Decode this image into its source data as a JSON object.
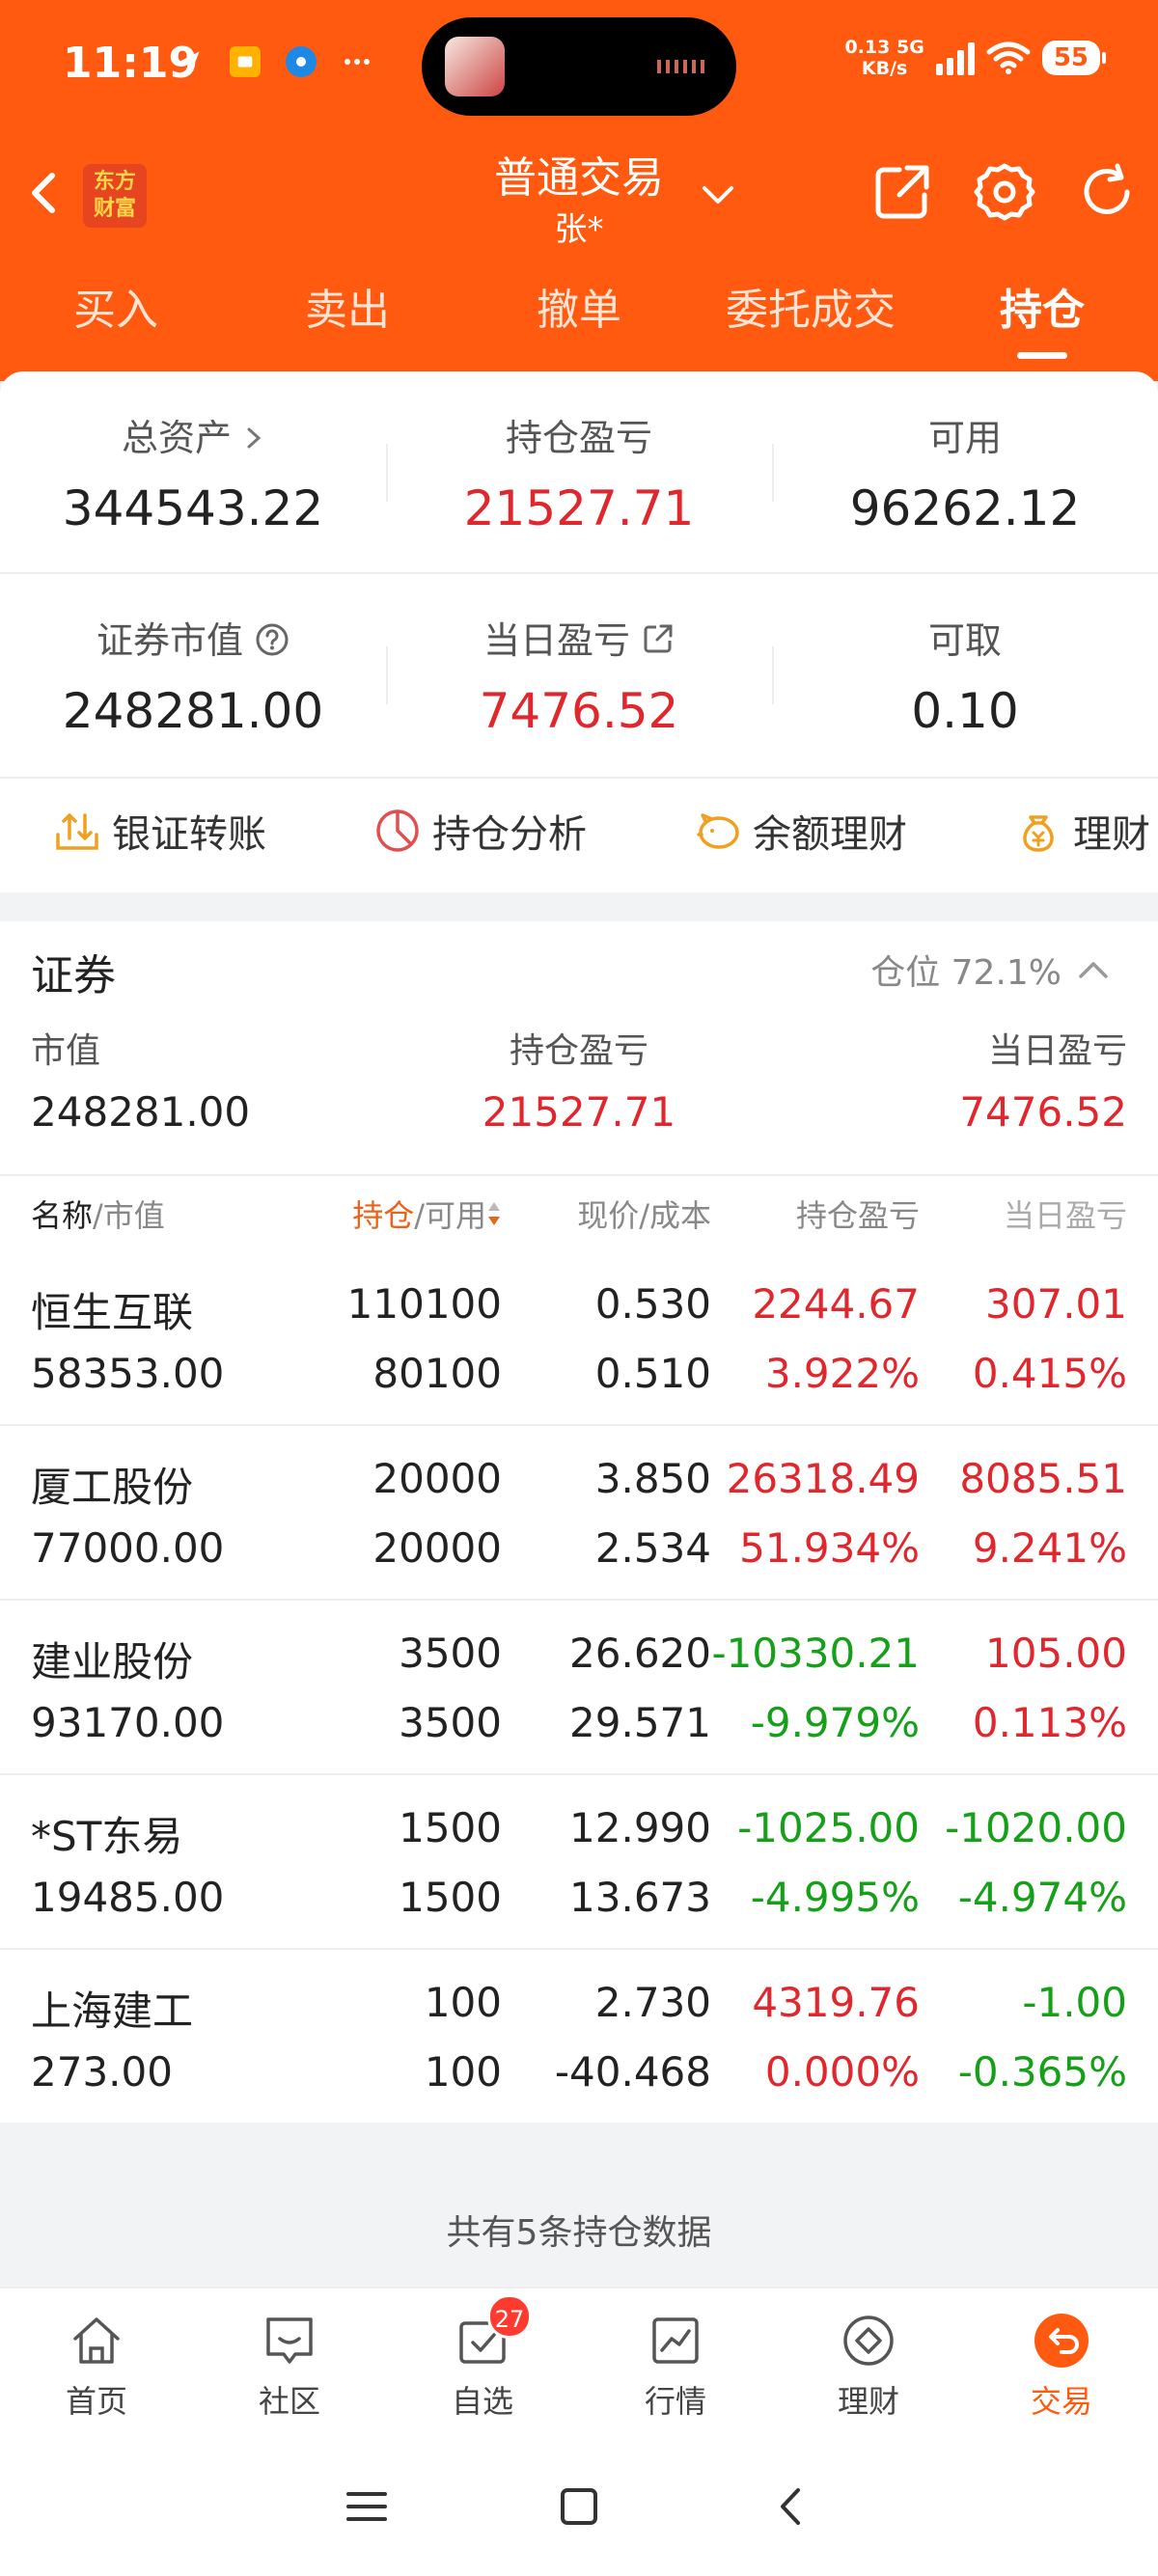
{
  "status_bar": {
    "time": "11:19",
    "speed_value": "0.13",
    "speed_unit": "KB/s",
    "network": "5G",
    "battery": "55",
    "left_icons": [
      "send-icon",
      "card-icon",
      "alipay-icon",
      "more-dots-icon"
    ]
  },
  "navbar": {
    "logo_line1": "东方",
    "logo_line2": "财富",
    "title": "普通交易",
    "subtitle": "张*"
  },
  "tabs": [
    {
      "label": "买入"
    },
    {
      "label": "卖出"
    },
    {
      "label": "撤单"
    },
    {
      "label": "委托成交"
    },
    {
      "label": "持仓",
      "active": true
    }
  ],
  "summary": {
    "total_assets_label": "总资产",
    "total_assets": "344543.22",
    "position_pl_label": "持仓盈亏",
    "position_pl": "21527.71",
    "available_label": "可用",
    "available": "96262.12",
    "market_value_label": "证券市值",
    "market_value": "248281.00",
    "daily_pl_label": "当日盈亏",
    "daily_pl": "7476.52",
    "withdrawable_label": "可取",
    "withdrawable": "0.10"
  },
  "tools": [
    {
      "label": "银证转账",
      "icon": "transfer-icon"
    },
    {
      "label": "持仓分析",
      "icon": "pie-analysis-icon"
    },
    {
      "label": "余额理财",
      "icon": "piggy-bank-icon"
    },
    {
      "label": "理财",
      "icon": "money-bag-icon"
    }
  ],
  "holdings": {
    "title": "证券",
    "position_ratio": "仓位 72.1%",
    "market_value_label": "市值",
    "market_value": "248281.00",
    "position_pl_label": "持仓盈亏",
    "position_pl": "21527.71",
    "daily_pl_label": "当日盈亏",
    "daily_pl": "7476.52",
    "columns": {
      "name": "名称",
      "name_sub": "/市值",
      "qty": "持仓",
      "qty_sub": "/可用",
      "price": "现价/成本",
      "pl": "持仓盈亏",
      "daily": "当日盈亏"
    },
    "rows": [
      {
        "name": "恒生互联",
        "value": "58353.00",
        "qty": "110100",
        "avail": "80100",
        "price": "0.530",
        "cost": "0.510",
        "pl": "2244.67",
        "pl_pct": "3.922%",
        "day": "307.01",
        "day_pct": "0.415%",
        "pl_color": "red",
        "day_color": "red"
      },
      {
        "name": "厦工股份",
        "value": "77000.00",
        "qty": "20000",
        "avail": "20000",
        "price": "3.850",
        "cost": "2.534",
        "pl": "26318.49",
        "pl_pct": "51.934%",
        "day": "8085.51",
        "day_pct": "9.241%",
        "pl_color": "red",
        "day_color": "red"
      },
      {
        "name": "建业股份",
        "value": "93170.00",
        "qty": "3500",
        "avail": "3500",
        "price": "26.620",
        "cost": "29.571",
        "pl": "-10330.21",
        "pl_pct": "-9.979%",
        "day": "105.00",
        "day_pct": "0.113%",
        "pl_color": "green",
        "day_color": "red"
      },
      {
        "name": "*ST东易",
        "value": "19485.00",
        "qty": "1500",
        "avail": "1500",
        "price": "12.990",
        "cost": "13.673",
        "pl": "-1025.00",
        "pl_pct": "-4.995%",
        "day": "-1020.00",
        "day_pct": "-4.974%",
        "pl_color": "green",
        "day_color": "green"
      },
      {
        "name": "上海建工",
        "value": "273.00",
        "qty": "100",
        "avail": "100",
        "price": "2.730",
        "cost": "-40.468",
        "pl": "4319.76",
        "pl_pct": "0.000%",
        "day": "-1.00",
        "day_pct": "-0.365%",
        "pl_color": "red",
        "day_color": "green"
      }
    ],
    "footer": "共有5条持仓数据"
  },
  "bottom_nav": [
    {
      "label": "首页",
      "icon": "home-icon"
    },
    {
      "label": "社区",
      "icon": "community-icon"
    },
    {
      "label": "自选",
      "icon": "watchlist-icon",
      "badge": "27"
    },
    {
      "label": "行情",
      "icon": "market-chart-icon"
    },
    {
      "label": "理财",
      "icon": "diamond-icon"
    },
    {
      "label": "交易",
      "icon": "trade-icon",
      "active": true
    }
  ],
  "colors": {
    "brand": "#ff5a0f",
    "up": "#e0272d",
    "down": "#16a01a"
  }
}
